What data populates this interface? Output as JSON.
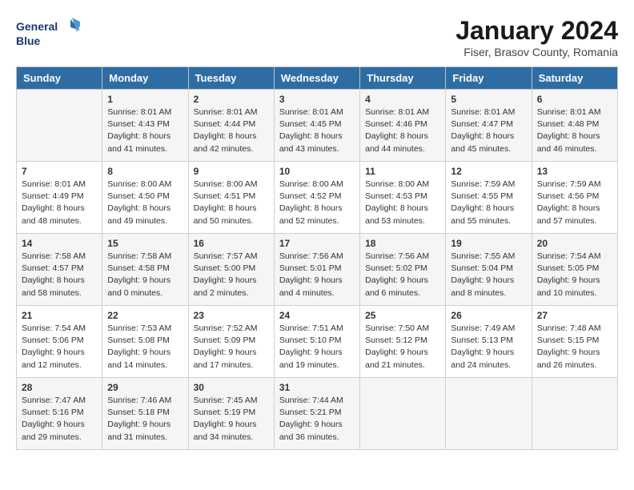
{
  "logo": {
    "line1": "General",
    "line2": "Blue"
  },
  "title": "January 2024",
  "location": "Fiser, Brasov County, Romania",
  "days_of_week": [
    "Sunday",
    "Monday",
    "Tuesday",
    "Wednesday",
    "Thursday",
    "Friday",
    "Saturday"
  ],
  "weeks": [
    [
      {
        "day": "",
        "info": ""
      },
      {
        "day": "1",
        "info": "Sunrise: 8:01 AM\nSunset: 4:43 PM\nDaylight: 8 hours\nand 41 minutes."
      },
      {
        "day": "2",
        "info": "Sunrise: 8:01 AM\nSunset: 4:44 PM\nDaylight: 8 hours\nand 42 minutes."
      },
      {
        "day": "3",
        "info": "Sunrise: 8:01 AM\nSunset: 4:45 PM\nDaylight: 8 hours\nand 43 minutes."
      },
      {
        "day": "4",
        "info": "Sunrise: 8:01 AM\nSunset: 4:46 PM\nDaylight: 8 hours\nand 44 minutes."
      },
      {
        "day": "5",
        "info": "Sunrise: 8:01 AM\nSunset: 4:47 PM\nDaylight: 8 hours\nand 45 minutes."
      },
      {
        "day": "6",
        "info": "Sunrise: 8:01 AM\nSunset: 4:48 PM\nDaylight: 8 hours\nand 46 minutes."
      }
    ],
    [
      {
        "day": "7",
        "info": "Sunrise: 8:01 AM\nSunset: 4:49 PM\nDaylight: 8 hours\nand 48 minutes."
      },
      {
        "day": "8",
        "info": "Sunrise: 8:00 AM\nSunset: 4:50 PM\nDaylight: 8 hours\nand 49 minutes."
      },
      {
        "day": "9",
        "info": "Sunrise: 8:00 AM\nSunset: 4:51 PM\nDaylight: 8 hours\nand 50 minutes."
      },
      {
        "day": "10",
        "info": "Sunrise: 8:00 AM\nSunset: 4:52 PM\nDaylight: 8 hours\nand 52 minutes."
      },
      {
        "day": "11",
        "info": "Sunrise: 8:00 AM\nSunset: 4:53 PM\nDaylight: 8 hours\nand 53 minutes."
      },
      {
        "day": "12",
        "info": "Sunrise: 7:59 AM\nSunset: 4:55 PM\nDaylight: 8 hours\nand 55 minutes."
      },
      {
        "day": "13",
        "info": "Sunrise: 7:59 AM\nSunset: 4:56 PM\nDaylight: 8 hours\nand 57 minutes."
      }
    ],
    [
      {
        "day": "14",
        "info": "Sunrise: 7:58 AM\nSunset: 4:57 PM\nDaylight: 8 hours\nand 58 minutes."
      },
      {
        "day": "15",
        "info": "Sunrise: 7:58 AM\nSunset: 4:58 PM\nDaylight: 9 hours\nand 0 minutes."
      },
      {
        "day": "16",
        "info": "Sunrise: 7:57 AM\nSunset: 5:00 PM\nDaylight: 9 hours\nand 2 minutes."
      },
      {
        "day": "17",
        "info": "Sunrise: 7:56 AM\nSunset: 5:01 PM\nDaylight: 9 hours\nand 4 minutes."
      },
      {
        "day": "18",
        "info": "Sunrise: 7:56 AM\nSunset: 5:02 PM\nDaylight: 9 hours\nand 6 minutes."
      },
      {
        "day": "19",
        "info": "Sunrise: 7:55 AM\nSunset: 5:04 PM\nDaylight: 9 hours\nand 8 minutes."
      },
      {
        "day": "20",
        "info": "Sunrise: 7:54 AM\nSunset: 5:05 PM\nDaylight: 9 hours\nand 10 minutes."
      }
    ],
    [
      {
        "day": "21",
        "info": "Sunrise: 7:54 AM\nSunset: 5:06 PM\nDaylight: 9 hours\nand 12 minutes."
      },
      {
        "day": "22",
        "info": "Sunrise: 7:53 AM\nSunset: 5:08 PM\nDaylight: 9 hours\nand 14 minutes."
      },
      {
        "day": "23",
        "info": "Sunrise: 7:52 AM\nSunset: 5:09 PM\nDaylight: 9 hours\nand 17 minutes."
      },
      {
        "day": "24",
        "info": "Sunrise: 7:51 AM\nSunset: 5:10 PM\nDaylight: 9 hours\nand 19 minutes."
      },
      {
        "day": "25",
        "info": "Sunrise: 7:50 AM\nSunset: 5:12 PM\nDaylight: 9 hours\nand 21 minutes."
      },
      {
        "day": "26",
        "info": "Sunrise: 7:49 AM\nSunset: 5:13 PM\nDaylight: 9 hours\nand 24 minutes."
      },
      {
        "day": "27",
        "info": "Sunrise: 7:48 AM\nSunset: 5:15 PM\nDaylight: 9 hours\nand 26 minutes."
      }
    ],
    [
      {
        "day": "28",
        "info": "Sunrise: 7:47 AM\nSunset: 5:16 PM\nDaylight: 9 hours\nand 29 minutes."
      },
      {
        "day": "29",
        "info": "Sunrise: 7:46 AM\nSunset: 5:18 PM\nDaylight: 9 hours\nand 31 minutes."
      },
      {
        "day": "30",
        "info": "Sunrise: 7:45 AM\nSunset: 5:19 PM\nDaylight: 9 hours\nand 34 minutes."
      },
      {
        "day": "31",
        "info": "Sunrise: 7:44 AM\nSunset: 5:21 PM\nDaylight: 9 hours\nand 36 minutes."
      },
      {
        "day": "",
        "info": ""
      },
      {
        "day": "",
        "info": ""
      },
      {
        "day": "",
        "info": ""
      }
    ]
  ]
}
